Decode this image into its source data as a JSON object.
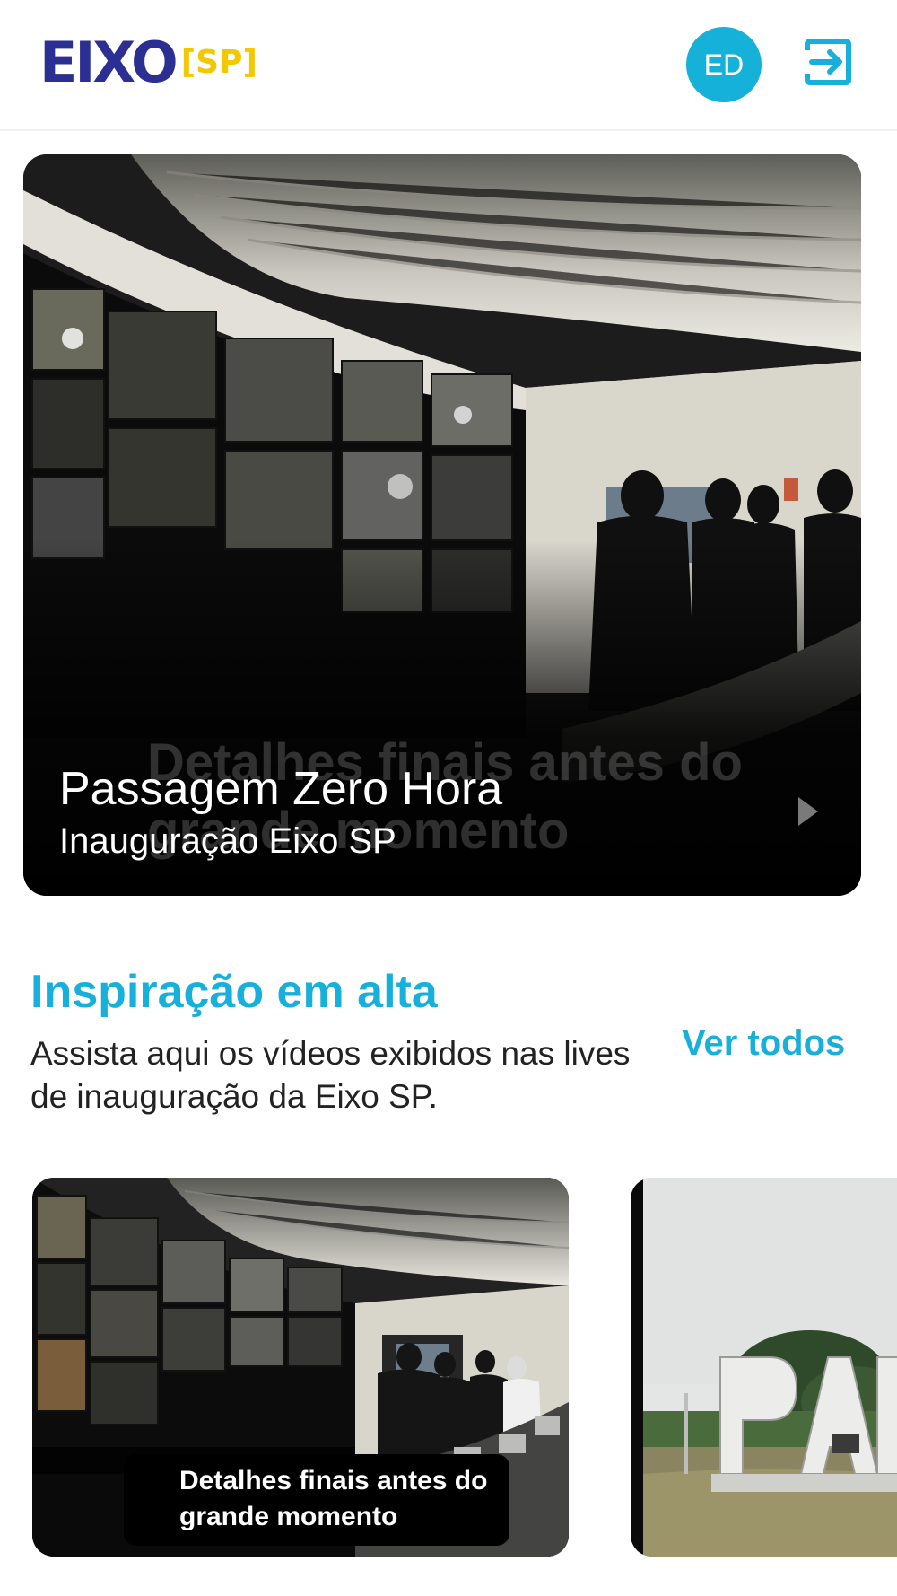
{
  "header": {
    "logo_text": "EIXO",
    "logo_badge": "[SP]",
    "avatar_initials": "ED",
    "logout_icon": "logout-arrow-icon"
  },
  "hero": {
    "ghost_text": "Detalhes finais antes do grande momento",
    "title": "Passagem Zero Hora",
    "subtitle": "Inauguração Eixo SP",
    "play_icon": "play-triangle-icon"
  },
  "section": {
    "title": "Inspiração em alta",
    "description": "Assista aqui os vídeos exibidos nas lives de inauguração da Eixo SP.",
    "see_all": "Ver todos"
  },
  "videos": [
    {
      "caption": "Detalhes finais antes do grande momento"
    },
    {
      "caption": ""
    }
  ],
  "colors": {
    "accent": "#17b0dc",
    "avatar_bg": "#16b1d9",
    "logo_blue": "#2b2f93",
    "logo_yellow": "#f3c800"
  }
}
